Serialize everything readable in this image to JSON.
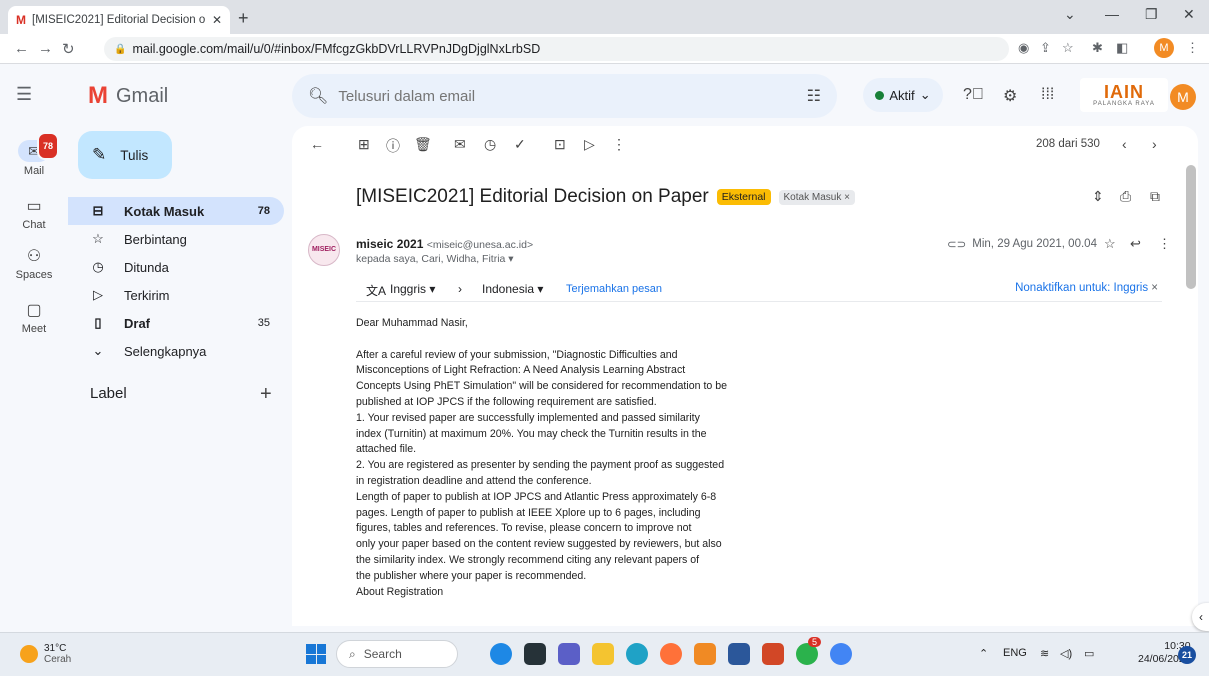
{
  "browser": {
    "tab_title": "[MISEIC2021] Editorial Decision o",
    "tab_close": "✕",
    "new_tab": "+",
    "url": "mail.google.com/mail/u/0/#inbox/FMfcgzGkbDVrLLRVPnJDgDjglNxLrbSD",
    "profile_initial": "M"
  },
  "gmail": {
    "logo_text": "Gmail",
    "search_placeholder": "Telusuri dalam email",
    "status_label": "Aktif",
    "org_logo_main": "IAIN",
    "org_logo_sub": "PALANGKA RAYA",
    "account_initial": "M"
  },
  "rail": {
    "mail_label": "Mail",
    "mail_badge": "78",
    "chat_label": "Chat",
    "spaces_label": "Spaces",
    "meet_label": "Meet"
  },
  "sidebar": {
    "compose_label": "Tulis",
    "items": [
      {
        "label": "Kotak Masuk",
        "count": "78"
      },
      {
        "label": "Berbintang",
        "count": ""
      },
      {
        "label": "Ditunda",
        "count": ""
      },
      {
        "label": "Terkirim",
        "count": ""
      },
      {
        "label": "Draf",
        "count": "35"
      },
      {
        "label": "Selengkapnya",
        "count": ""
      }
    ],
    "label_header": "Label",
    "label_add": "+"
  },
  "message": {
    "page_count": "208 dari 530",
    "subject": "[MISEIC2021] Editorial Decision on Paper",
    "chip_external": "Eksternal",
    "chip_inbox": "Kotak Masuk ×",
    "sender_name": "miseic 2021",
    "sender_email": "<miseic@unesa.ac.id>",
    "sender_avatar_text": "MISEIC",
    "recipients": "kepada saya, Cari, Widha, Fitria ▾",
    "date": "Min, 29 Agu 2021, 00.04",
    "translate": {
      "from_lang": "Inggris",
      "to_lang": "Indonesia",
      "translate_link": "Terjemahkan pesan",
      "disable": "Nonaktifkan untuk: Inggris"
    },
    "body_lines": [
      "Dear Muhammad Nasir,",
      "",
      "After a careful review of your submission, \"Diagnostic Difficulties and",
      "Misconceptions of Light Refraction: A Need Analysis Learning Abstract",
      "Concepts Using PhET Simulation\" will be considered for  recommendation to be",
      "published at IOP JPCS if the following requirement are satisfied.",
      "1. Your revised paper are successfully implemented and passed similarity",
      "index (Turnitin) at maximum 20%. You may check the Turnitin results in the",
      "attached file.",
      "2. You are registered as presenter by sending the payment proof as suggested",
      "in registration deadline and attend the conference.",
      "Length of paper to publish at IOP JPCS and Atlantic Press approximately 6-8",
      "pages. Length of paper to publish at IEEE Xplore up to 6 pages, including",
      "figures, tables and references. To revise, please concern to improve not",
      "only your paper based on the content review suggested by reviewers, but also",
      "the similarity index. We strongly recommend citing any relevant papers of",
      "the publisher where your paper is recommended.",
      "About Registration"
    ]
  },
  "taskbar": {
    "temperature": "31°C",
    "weather": "Cerah",
    "search_placeholder": "Search",
    "language": "ENG",
    "time": "10:30",
    "date": "24/06/2023",
    "notification_count": "21",
    "messenger_badge": "5"
  }
}
